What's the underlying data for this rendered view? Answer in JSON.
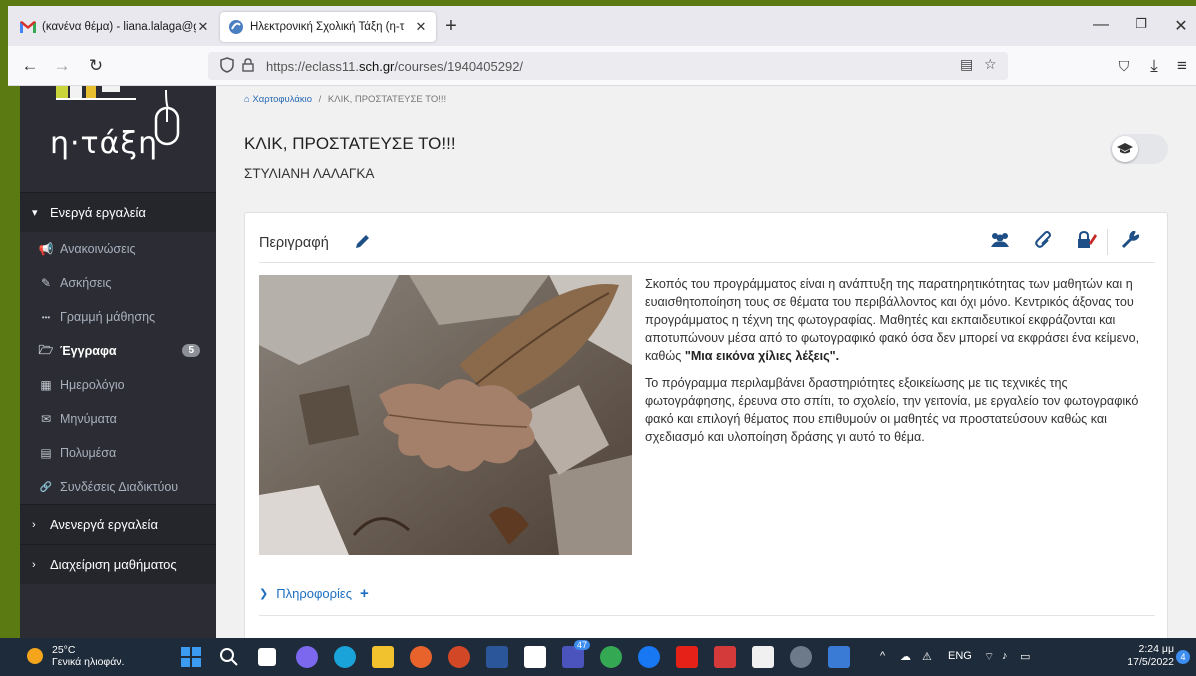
{
  "browser": {
    "tabs": [
      {
        "title": "(κανένα θέμα) - liana.lalaga@gr",
        "favicon": "gmail-icon"
      },
      {
        "title": "Ηλεκτρονική Σχολική Τάξη (η-τ",
        "favicon": "eclass-icon"
      }
    ],
    "url_prefix": "https://eclass11.",
    "url_domain": "sch.gr",
    "url_path": "/courses/1940405292/"
  },
  "sidebar": {
    "logo_text": "η·τάξη",
    "active_tools_label": "Ενεργά εργαλεία",
    "items": [
      {
        "label": "Ανακοινώσεις",
        "icon": "megaphone-icon",
        "glyph": "📢"
      },
      {
        "label": "Ασκήσεις",
        "icon": "edit-icon",
        "glyph": "✎"
      },
      {
        "label": "Γραμμή μάθησης",
        "icon": "ellipsis-icon",
        "glyph": "•••"
      },
      {
        "label": "Έγγραφα",
        "icon": "folder-icon",
        "glyph": "🗁",
        "badge": "5"
      },
      {
        "label": "Ημερολόγιο",
        "icon": "calendar-icon",
        "glyph": "▦"
      },
      {
        "label": "Μηνύματα",
        "icon": "envelope-icon",
        "glyph": "✉"
      },
      {
        "label": "Πολυμέσα",
        "icon": "film-icon",
        "glyph": "▤"
      },
      {
        "label": "Συνδέσεις Διαδικτύου",
        "icon": "link-icon",
        "glyph": "🔗"
      }
    ],
    "inactive_tools_label": "Ανενεργά εργαλεία",
    "course_admin_label": "Διαχείριση μαθήματος"
  },
  "breadcrumb": {
    "home": "Χαρτοφυλάκιο",
    "separator": "/",
    "current": "ΚΛΙΚ, ΠΡΟΣΤΑΤΕΥΣΕ ΤΟ!!!"
  },
  "course": {
    "title": "ΚΛΙΚ, ΠΡΟΣΤΑΤΕΥΣΕ ΤΟ!!!",
    "teacher": "ΣΤΥΛΙΑΝΗ ΛΑΛΑΓΚΑ"
  },
  "description": {
    "heading": "Περιγραφή",
    "para1_a": "Σκοπός του προγράμματος είναι η ανάπτυξη της παρατηρητικότητας των μαθητών και η ευαισθητοποίηση τους σε θέματα του περιβάλλοντος και όχι μόνο. Κεντρικός άξονας του προγράμματος η τέχνη της φωτογραφίας. Μαθητές και εκπαιδευτικοί εκφράζονται και αποτυπώνουν μέσα από το φωτογραφικό φακό όσα δεν μπορεί να εκφράσει ένα κείμενο, καθώς ",
    "para1_bold": "\"Μια εικόνα χίλιες λέξεις\".",
    "para2": "Το πρόγραμμα περιλαμβάνει δραστηριότητες εξοικείωσης με τις τεχνικές της φωτογράφησης, έρευνα στο σπίτι, το σχολείο, την γειτονία, με εργαλείο τον φωτογραφικό φακό και επιλογή θέματος που επιθυμούν οι μαθητές να προστατεύσουν καθώς και σχεδιασμό και υλοποίηση δράσης γι αυτό το θέμα.",
    "info_label": "Πληροφορίες"
  },
  "taskbar": {
    "temperature": "25°C",
    "weather_text": "Γενικά ηλιοφάν.",
    "language": "ENG",
    "time": "2:24 μμ",
    "date": "17/5/2022",
    "notifications": "4",
    "teams_badge": "47"
  },
  "colors": {
    "sidebar_bg": "#2c2d34",
    "link": "#1e6fc2",
    "taskbar_bg": "#1e2b3a"
  }
}
